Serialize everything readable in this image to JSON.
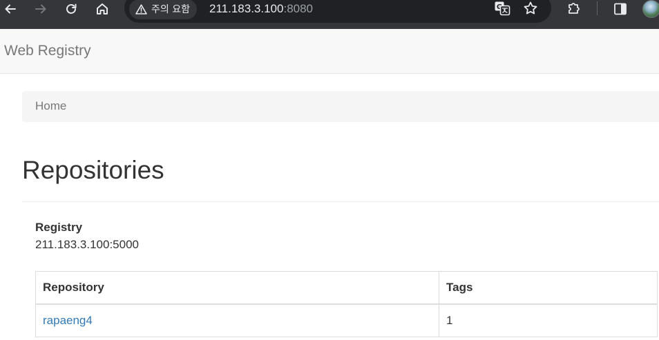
{
  "browser": {
    "security_warning": "주의 요함",
    "url_host": "211.183.3.100",
    "url_port": ":8080",
    "icons": {
      "back": "arrow-left-icon",
      "forward": "arrow-right-icon",
      "reload": "reload-icon",
      "home": "home-icon",
      "warning": "warning-triangle-icon",
      "translate": "translate-icon",
      "bookmark": "star-icon",
      "extensions": "puzzle-icon",
      "side_panel": "side-panel-icon",
      "profile": "avatar"
    }
  },
  "navbar": {
    "brand": "Web Registry"
  },
  "breadcrumb": {
    "items": [
      "Home"
    ]
  },
  "page": {
    "title": "Repositories"
  },
  "registry": {
    "label": "Registry",
    "value": "211.183.3.100:5000"
  },
  "table": {
    "columns": [
      "Repository",
      "Tags"
    ],
    "rows": [
      {
        "repository": "rapaeng4",
        "tags": "1"
      }
    ]
  },
  "colors": {
    "chrome_bg": "#35363a",
    "omnibox_bg": "#202124",
    "navbar_bg": "#f8f8f8",
    "link": "#337ab7",
    "muted_text": "#777777"
  }
}
